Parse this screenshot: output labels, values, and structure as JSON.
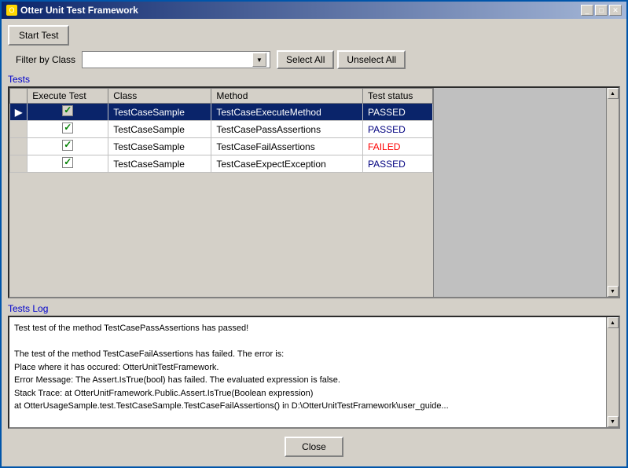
{
  "window": {
    "title": "Otter Unit Test Framework",
    "icon": "O"
  },
  "title_buttons": {
    "minimize": "_",
    "maximize": "□",
    "close": "✕"
  },
  "toolbar": {
    "start_test_label": "Start Test"
  },
  "filter": {
    "label": "Filter by Class",
    "placeholder": "",
    "select_all_label": "Select All",
    "unselect_all_label": "Unselect All"
  },
  "tests_section": {
    "label": "Tests",
    "columns": [
      "",
      "Execute Test",
      "Class",
      "Method",
      "Test status"
    ],
    "rows": [
      {
        "arrow": "▶",
        "checked": true,
        "class": "TestCaseSample",
        "method": "TestCaseExecuteMethod",
        "status": "PASSED",
        "selected": true
      },
      {
        "arrow": "",
        "checked": true,
        "class": "TestCaseSample",
        "method": "TestCasePassAssertions",
        "status": "PASSED",
        "selected": false
      },
      {
        "arrow": "",
        "checked": true,
        "class": "TestCaseSample",
        "method": "TestCaseFailAssertions",
        "status": "FAILED",
        "selected": false
      },
      {
        "arrow": "",
        "checked": true,
        "class": "TestCaseSample",
        "method": "TestCaseExpectException",
        "status": "PASSED",
        "selected": false
      }
    ]
  },
  "log_section": {
    "label": "Tests Log",
    "content": "Test test of the method TestCasePassAssertions has passed!\n\nThe test of the method TestCaseFailAssertions has failed. The error is:\nPlace where it has occured: OtterUnitTestFramework.\nError Message: The Assert.IsTrue(bool) has failed. The evaluated expression is false.\nStack Trace:   at OtterUnitFramework.Public.Assert.IsTrue(Boolean expression)\n  at OtterUsageSample.test.TestCaseSample.TestCaseFailAssertions() in D:\\OtterUnitTestFramework\\user_guide..."
  },
  "footer": {
    "close_label": "Close"
  }
}
